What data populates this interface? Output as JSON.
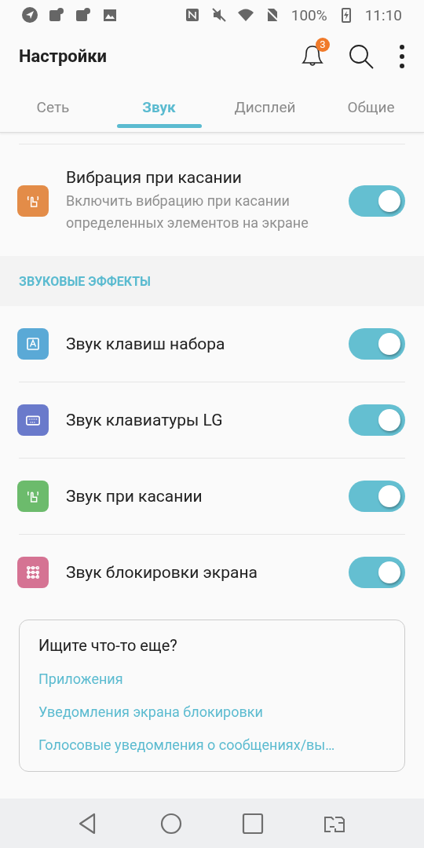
{
  "status_bar": {
    "battery": "100%",
    "time": "11:10"
  },
  "app_bar": {
    "title": "Настройки",
    "notification_count": "3"
  },
  "tabs": [
    {
      "label": "Сеть",
      "selected": false
    },
    {
      "label": "Звук",
      "selected": true
    },
    {
      "label": "Дисплей",
      "selected": false
    },
    {
      "label": "Общие",
      "selected": false
    }
  ],
  "top_setting": {
    "title": "Вибрация при касании",
    "description": "Включить вибрацию при касании определенных элементов на экране",
    "on": true,
    "color": "#e38c48"
  },
  "section": {
    "title": "ЗВУКОВЫЕ ЭФФЕКТЫ",
    "items": [
      {
        "title": "Звук клавиш набора",
        "on": true,
        "color": "#5aa9d6"
      },
      {
        "title": "Звук клавиатуры LG",
        "on": true,
        "color": "#6a7acb"
      },
      {
        "title": "Звук при касании",
        "on": true,
        "color": "#6cbb6c"
      },
      {
        "title": "Звук блокировки экрана",
        "on": true,
        "color": "#d57393"
      }
    ]
  },
  "search_card": {
    "title": "Ищите что-то еще?",
    "links": [
      "Приложения",
      "Уведомления экрана блокировки",
      "Голосовые уведомления о сообщениях/вы…"
    ]
  }
}
